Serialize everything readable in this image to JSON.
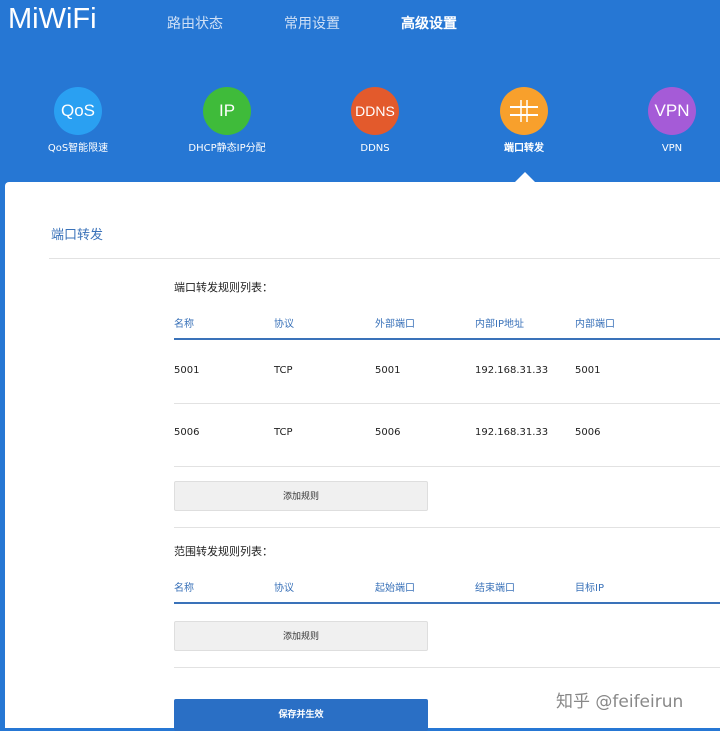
{
  "brand": {
    "logo_text": "MiWiFi"
  },
  "topnav": [
    {
      "label": "路由状态",
      "active": false
    },
    {
      "label": "常用设置",
      "active": false
    },
    {
      "label": "高级设置",
      "active": true
    }
  ],
  "apps": [
    {
      "icon_text": "QoS",
      "label": "QoS智能限速",
      "color": "#2aa0f2",
      "active": false
    },
    {
      "icon_text": "IP",
      "label": "DHCP静态IP分配",
      "color": "#3fbb3a",
      "active": false
    },
    {
      "icon_text": "DDNS",
      "label": "DDNS",
      "color": "#e35a2c",
      "active": false
    },
    {
      "icon_text": "",
      "label": "端口转发",
      "color": "#f8a02c",
      "active": true
    },
    {
      "icon_text": "VPN",
      "label": "VPN",
      "color": "#a55bd7",
      "active": false
    }
  ],
  "page": {
    "title": "端口转发"
  },
  "port_forward": {
    "title": "端口转发规则列表：",
    "columns": [
      "名称",
      "协议",
      "外部端口",
      "内部IP地址",
      "内部端口"
    ],
    "rows": [
      [
        "5001",
        "TCP",
        "5001",
        "192.168.31.33",
        "5001"
      ],
      [
        "5006",
        "TCP",
        "5006",
        "192.168.31.33",
        "5006"
      ]
    ],
    "add_label": "添加规则"
  },
  "range_forward": {
    "title": "范围转发规则列表：",
    "columns": [
      "名称",
      "协议",
      "起始端口",
      "结束端口",
      "目标IP"
    ],
    "add_label": "添加规则"
  },
  "save_label": "保存并生效",
  "watermark": "知乎 @feifeirun"
}
